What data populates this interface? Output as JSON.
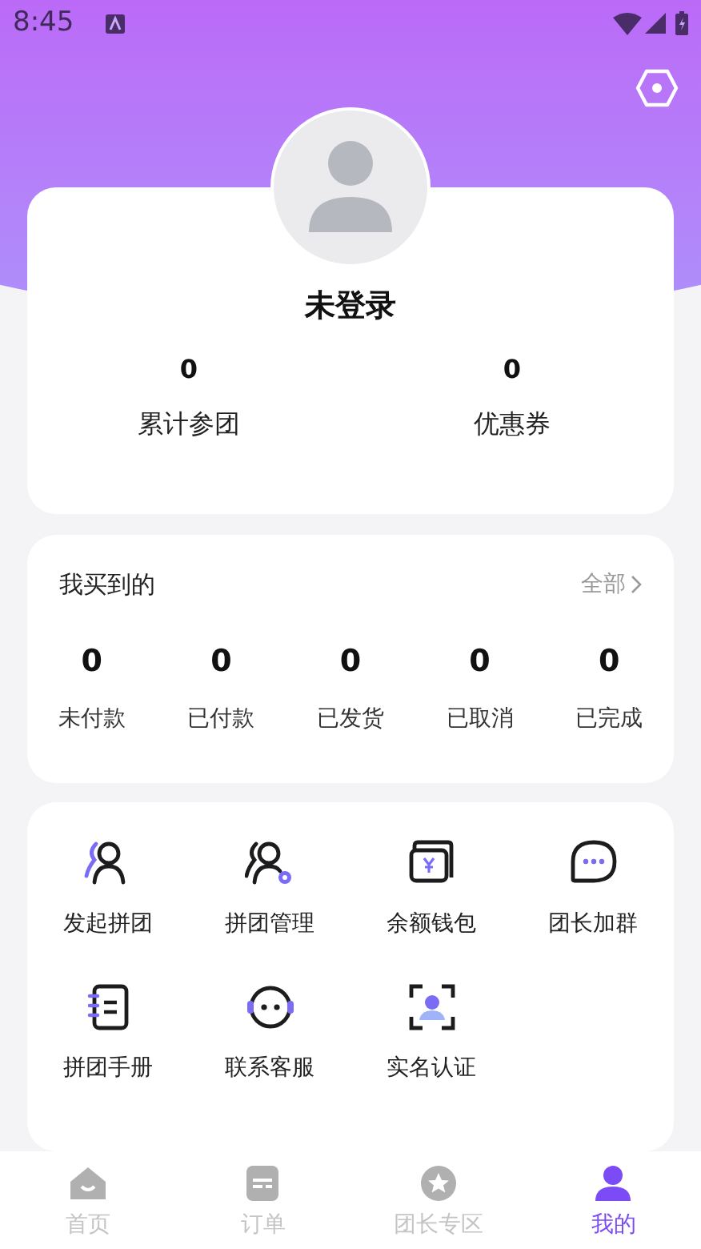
{
  "status_bar": {
    "time": "8:45"
  },
  "profile": {
    "name": "未登录",
    "stats": [
      {
        "value": "0",
        "label": "累计参团"
      },
      {
        "value": "0",
        "label": "优惠券"
      }
    ]
  },
  "orders": {
    "title": "我买到的",
    "more": "全部",
    "items": [
      {
        "value": "0",
        "label": "未付款"
      },
      {
        "value": "0",
        "label": "已付款"
      },
      {
        "value": "0",
        "label": "已发货"
      },
      {
        "value": "0",
        "label": "已取消"
      },
      {
        "value": "0",
        "label": "已完成"
      }
    ]
  },
  "services": [
    {
      "label": "发起拼团"
    },
    {
      "label": "拼团管理"
    },
    {
      "label": "余额钱包"
    },
    {
      "label": "团长加群"
    },
    {
      "label": "拼团手册"
    },
    {
      "label": "联系客服"
    },
    {
      "label": "实名认证"
    }
  ],
  "tabs": [
    {
      "label": "首页",
      "selected": false
    },
    {
      "label": "订单",
      "selected": false
    },
    {
      "label": "团长专区",
      "selected": false
    },
    {
      "label": "我的",
      "selected": true
    }
  ]
}
